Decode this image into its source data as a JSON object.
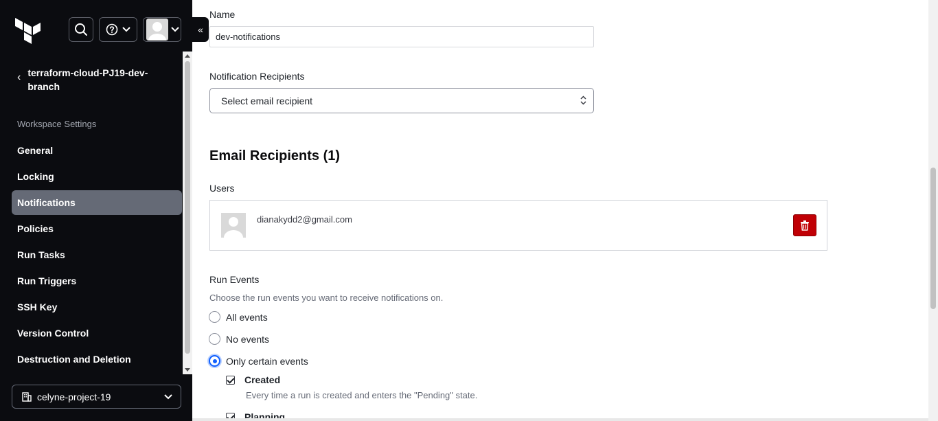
{
  "header": {
    "logo_icon": "terraform-logo-icon",
    "search_icon": "search-icon",
    "help_icon": "help-circle-icon",
    "user_icon": "user-avatar-icon",
    "chevron_icon": "chevron-down-icon",
    "collapse_glyph": "«"
  },
  "sidebar": {
    "back_chevron": "‹",
    "workspace_name": "terraform-cloud-PJ19-dev-branch",
    "section_label": "Workspace Settings",
    "items": [
      {
        "label": "General",
        "active": false
      },
      {
        "label": "Locking",
        "active": false
      },
      {
        "label": "Notifications",
        "active": true
      },
      {
        "label": "Policies",
        "active": false
      },
      {
        "label": "Run Tasks",
        "active": false
      },
      {
        "label": "Run Triggers",
        "active": false
      },
      {
        "label": "SSH Key",
        "active": false
      },
      {
        "label": "Version Control",
        "active": false
      },
      {
        "label": "Destruction and Deletion",
        "active": false
      }
    ],
    "project_icon": "building-icon",
    "project_name": "celyne-project-19"
  },
  "form": {
    "name_label": "Name",
    "name_value": "dev-notifications",
    "recipients_label": "Notification Recipients",
    "recipients_select": "Select email recipient",
    "email_heading": "Email Recipients (1)",
    "users_label": "Users",
    "users": [
      {
        "email": "dianakydd2@gmail.com"
      }
    ],
    "delete_icon": "trash-icon",
    "run_events_label": "Run Events",
    "run_events_help": "Choose the run events you want to receive notifications on.",
    "options": [
      {
        "label": "All events",
        "checked": false
      },
      {
        "label": "No events",
        "checked": false
      },
      {
        "label": "Only certain events",
        "checked": true
      }
    ],
    "events": [
      {
        "label": "Created",
        "checked": true,
        "description": "Every time a run is created and enters the \"Pending\" state."
      },
      {
        "label": "Planning",
        "checked": true
      }
    ]
  },
  "colors": {
    "sidebar_bg": "#0b0c10",
    "active_item": "#656a76",
    "delete_red": "#c00005",
    "radio_blue": "#1060ff"
  }
}
